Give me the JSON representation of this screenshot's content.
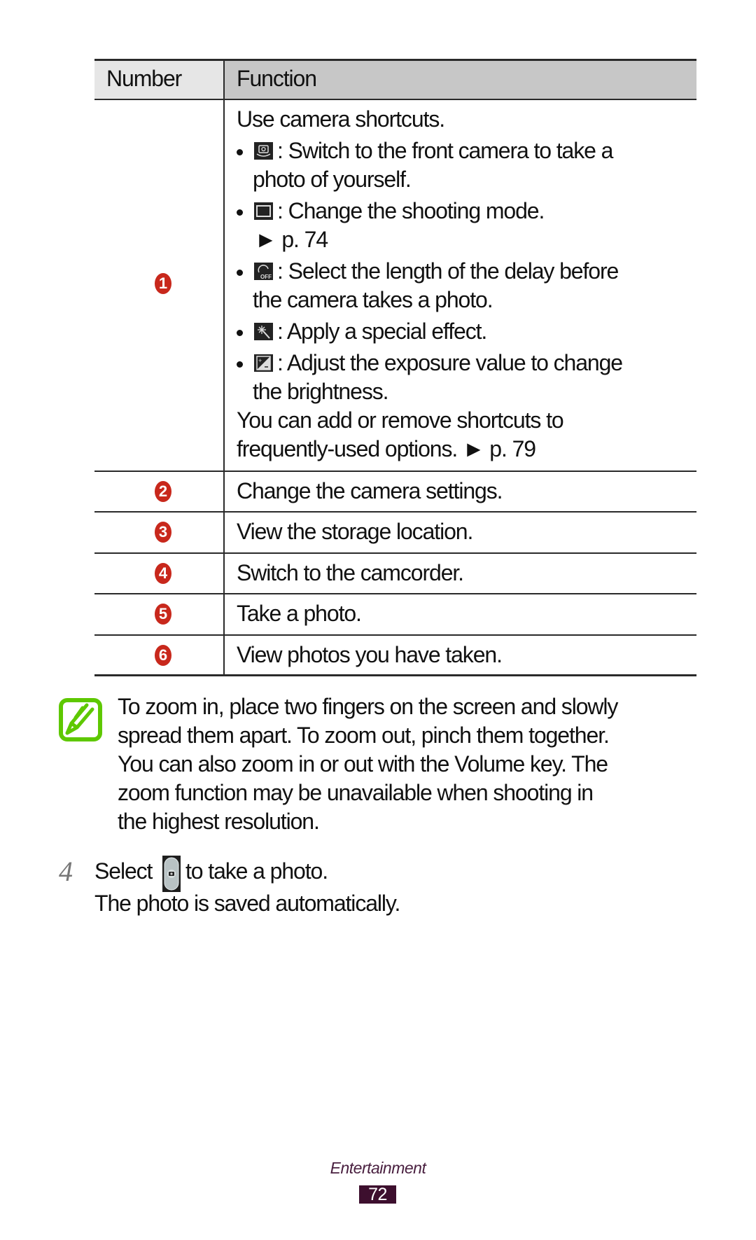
{
  "table": {
    "headers": {
      "number": "Number",
      "function": "Function"
    },
    "rows": [
      {
        "number": "1",
        "intro": "Use camera shortcuts.",
        "bullets": [
          {
            "icon": "switch-camera-icon",
            "lines": [
              ": Switch to the front camera to take a",
              "photo of yourself."
            ]
          },
          {
            "icon": "shooting-mode-icon",
            "lines": [
              ": Change the shooting mode.",
              "► p. 74"
            ]
          },
          {
            "icon": "timer-off-icon",
            "lines": [
              ": Select the length of the delay before",
              "the camera takes a photo."
            ]
          },
          {
            "icon": "special-effect-icon",
            "lines": [
              ": Apply a special effect."
            ]
          },
          {
            "icon": "exposure-icon",
            "lines": [
              ": Adjust the exposure value to change",
              "the brightness."
            ]
          }
        ],
        "outro": [
          "You can add or remove shortcuts to",
          "frequently-used options. ► p. 79"
        ]
      },
      {
        "number": "2",
        "text": "Change the camera settings."
      },
      {
        "number": "3",
        "text": "View the storage location."
      },
      {
        "number": "4",
        "text": "Switch to the camcorder."
      },
      {
        "number": "5",
        "text": "Take a photo."
      },
      {
        "number": "6",
        "text": "View photos you have taken."
      }
    ]
  },
  "note": {
    "icon": "note-pencil-icon",
    "lines": [
      "To zoom in, place two fingers on the screen and slowly",
      "spread them apart. To zoom out, pinch them together.",
      "You can also zoom in or out with the Volume key. The",
      "zoom function may be unavailable when shooting in",
      "the highest resolution."
    ]
  },
  "step": {
    "number": "4",
    "before_icon": "Select",
    "after_icon": "to take a photo.",
    "icon": "shutter-button-icon",
    "result": "The photo is saved automatically."
  },
  "footer": {
    "section": "Entertainment",
    "page": "72"
  },
  "colors": {
    "badge": "#c8281c",
    "note_green": "#5ec800",
    "footer_purple": "#3d0f2e"
  }
}
